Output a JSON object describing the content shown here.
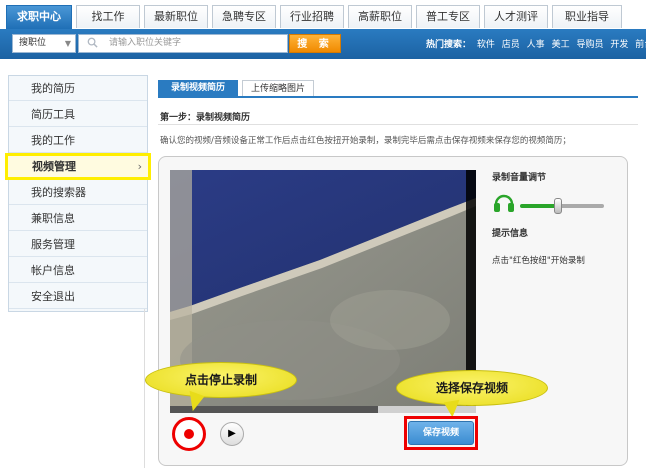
{
  "tabs": [
    {
      "label": "求职中心",
      "active": true
    },
    {
      "label": "找工作"
    },
    {
      "label": "最新职位"
    },
    {
      "label": "急聘专区"
    },
    {
      "label": "行业招聘"
    },
    {
      "label": "高薪职位"
    },
    {
      "label": "普工专区"
    },
    {
      "label": "人才测评"
    },
    {
      "label": "职业指导"
    }
  ],
  "search": {
    "type_label": "搜职位",
    "placeholder": "请输入职位关键字",
    "button_label": "搜 索",
    "hot_label": "热门搜索：",
    "hot_terms": [
      "软件",
      "店员",
      "人事",
      "美工",
      "导购员",
      "开发",
      "前台"
    ]
  },
  "sidebar": {
    "items": [
      {
        "label": "我的简历"
      },
      {
        "label": "简历工具"
      },
      {
        "label": "我的工作"
      },
      {
        "label": "视频管理",
        "active": true
      },
      {
        "label": "我的搜索器"
      },
      {
        "label": "兼职信息"
      },
      {
        "label": "服务管理"
      },
      {
        "label": "帐户信息"
      },
      {
        "label": "安全退出"
      }
    ],
    "chevron": "›"
  },
  "main": {
    "tab_record": "录制视频简历",
    "tab_upload": "上传缩略图片",
    "step_title": "第一步：录制视频简历",
    "instructions": "确认您的视频/音频设备正常工作后点击红色按扭开始录制，录制完毕后需点击保存视频来保存您的视频简历；",
    "progress": 0.68,
    "save_label": "保存视频",
    "bubble_stop": "点击停止录制",
    "bubble_save": "选择保存视频",
    "volume_title": "录制音量调节",
    "volume_level": 0.45,
    "tip_title": "提示信息",
    "tip_text": "点击\"红色按纽\"开始录制"
  },
  "colors": {
    "brand_blue": "#2a7bc1",
    "search_orange": "#f08a00",
    "highlight_yellow": "#ffee00",
    "record_red": "#ee0000"
  }
}
